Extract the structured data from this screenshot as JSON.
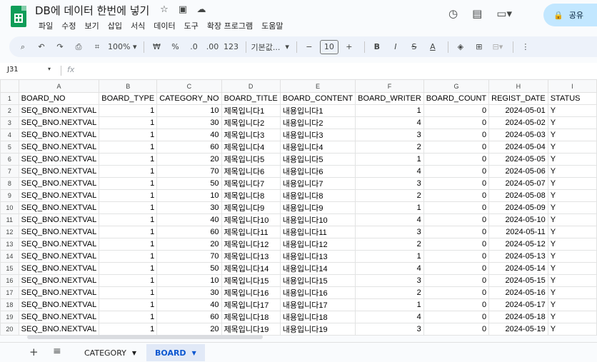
{
  "app": {
    "title": "DB에 데이터 한번에 넣기",
    "share_label": "공유"
  },
  "menu": [
    "파일",
    "수정",
    "보기",
    "삽입",
    "서식",
    "데이터",
    "도구",
    "확장 프로그램",
    "도움말"
  ],
  "toolbar": {
    "zoom": "100%",
    "currency": "₩",
    "percent": "%",
    "decrease_decimal": ".0",
    "increase_decimal": ".00",
    "number_format": "123",
    "font": "기본값...",
    "font_size": "10"
  },
  "formula_bar": {
    "name_box": "J31",
    "fx": "fx",
    "value": ""
  },
  "columns": [
    "A",
    "B",
    "C",
    "D",
    "E",
    "F",
    "G",
    "H",
    "I"
  ],
  "rows": [
    [
      "BOARD_NO",
      "BOARD_TYPE",
      "CATEGORY_NO",
      "BOARD_TITLE",
      "BOARD_CONTENT",
      "BOARD_WRITER",
      "BOARD_COUNT",
      "REGIST_DATE",
      "STATUS"
    ],
    [
      "SEQ_BNO.NEXTVAL",
      "1",
      "10",
      "제목입니다1",
      "내용입니다1",
      "1",
      "0",
      "2024-05-01",
      "Y"
    ],
    [
      "SEQ_BNO.NEXTVAL",
      "1",
      "30",
      "제목입니다2",
      "내용입니다2",
      "4",
      "0",
      "2024-05-02",
      "Y"
    ],
    [
      "SEQ_BNO.NEXTVAL",
      "1",
      "40",
      "제목입니다3",
      "내용입니다3",
      "3",
      "0",
      "2024-05-03",
      "Y"
    ],
    [
      "SEQ_BNO.NEXTVAL",
      "1",
      "60",
      "제목입니다4",
      "내용입니다4",
      "2",
      "0",
      "2024-05-04",
      "Y"
    ],
    [
      "SEQ_BNO.NEXTVAL",
      "1",
      "20",
      "제목입니다5",
      "내용입니다5",
      "1",
      "0",
      "2024-05-05",
      "Y"
    ],
    [
      "SEQ_BNO.NEXTVAL",
      "1",
      "70",
      "제목입니다6",
      "내용입니다6",
      "4",
      "0",
      "2024-05-06",
      "Y"
    ],
    [
      "SEQ_BNO.NEXTVAL",
      "1",
      "50",
      "제목입니다7",
      "내용입니다7",
      "3",
      "0",
      "2024-05-07",
      "Y"
    ],
    [
      "SEQ_BNO.NEXTVAL",
      "1",
      "10",
      "제목입니다8",
      "내용입니다8",
      "2",
      "0",
      "2024-05-08",
      "Y"
    ],
    [
      "SEQ_BNO.NEXTVAL",
      "1",
      "30",
      "제목입니다9",
      "내용입니다9",
      "1",
      "0",
      "2024-05-09",
      "Y"
    ],
    [
      "SEQ_BNO.NEXTVAL",
      "1",
      "40",
      "제목입니다10",
      "내용입니다10",
      "4",
      "0",
      "2024-05-10",
      "Y"
    ],
    [
      "SEQ_BNO.NEXTVAL",
      "1",
      "60",
      "제목입니다11",
      "내용입니다11",
      "3",
      "0",
      "2024-05-11",
      "Y"
    ],
    [
      "SEQ_BNO.NEXTVAL",
      "1",
      "20",
      "제목입니다12",
      "내용입니다12",
      "2",
      "0",
      "2024-05-12",
      "Y"
    ],
    [
      "SEQ_BNO.NEXTVAL",
      "1",
      "70",
      "제목입니다13",
      "내용입니다13",
      "1",
      "0",
      "2024-05-13",
      "Y"
    ],
    [
      "SEQ_BNO.NEXTVAL",
      "1",
      "50",
      "제목입니다14",
      "내용입니다14",
      "4",
      "0",
      "2024-05-14",
      "Y"
    ],
    [
      "SEQ_BNO.NEXTVAL",
      "1",
      "10",
      "제목입니다15",
      "내용입니다15",
      "3",
      "0",
      "2024-05-15",
      "Y"
    ],
    [
      "SEQ_BNO.NEXTVAL",
      "1",
      "30",
      "제목입니다16",
      "내용입니다16",
      "2",
      "0",
      "2024-05-16",
      "Y"
    ],
    [
      "SEQ_BNO.NEXTVAL",
      "1",
      "40",
      "제목입니다17",
      "내용입니다17",
      "1",
      "0",
      "2024-05-17",
      "Y"
    ],
    [
      "SEQ_BNO.NEXTVAL",
      "1",
      "60",
      "제목입니다18",
      "내용입니다18",
      "4",
      "0",
      "2024-05-18",
      "Y"
    ],
    [
      "SEQ_BNO.NEXTVAL",
      "1",
      "20",
      "제목입니다19",
      "내용입니다19",
      "3",
      "0",
      "2024-05-19",
      "Y"
    ]
  ],
  "sheet_tabs": [
    {
      "label": "CATEGORY",
      "active": false
    },
    {
      "label": "BOARD",
      "active": true
    }
  ]
}
